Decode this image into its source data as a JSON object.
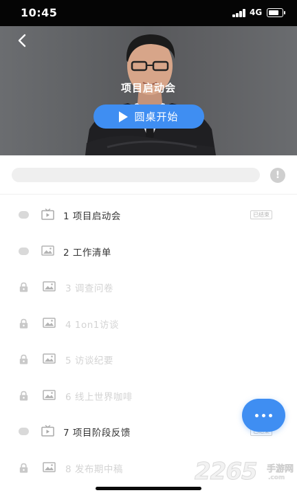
{
  "status_bar": {
    "time": "10:45",
    "network": "4G",
    "battery_level": 0.8
  },
  "header": {
    "title": "项目启动会"
  },
  "start_button": {
    "label": "圆桌开始"
  },
  "info_icon": {
    "glyph": "!"
  },
  "items": [
    {
      "number": "1",
      "title": "项目启动会",
      "label": "1  项目启动会",
      "status_icon": "dot",
      "type_icon": "video-icon",
      "locked": false,
      "badge": "已结束"
    },
    {
      "number": "2",
      "title": "工作清单",
      "label": "2  工作清单",
      "status_icon": "dot",
      "type_icon": "image-icon",
      "locked": false
    },
    {
      "number": "3",
      "title": "调查问卷",
      "label": "3  调查问卷",
      "status_icon": "lock-icon",
      "type_icon": "image-icon",
      "locked": true
    },
    {
      "number": "4",
      "title": "1on1访谈",
      "label": "4  1on1访谈",
      "status_icon": "lock-icon",
      "type_icon": "image-icon",
      "locked": true
    },
    {
      "number": "5",
      "title": "访谈纪要",
      "label": "5  访谈纪要",
      "status_icon": "lock-icon",
      "type_icon": "image-icon",
      "locked": true
    },
    {
      "number": "6",
      "title": "线上世界咖啡",
      "label": "6  线上世界咖啡",
      "status_icon": "lock-icon",
      "type_icon": "image-icon",
      "locked": true
    },
    {
      "number": "7",
      "title": "项目阶段反馈",
      "label": "7  项目阶段反馈",
      "status_icon": "dot",
      "type_icon": "video-icon",
      "locked": false,
      "badge": "已结束"
    },
    {
      "number": "8",
      "title": "发布期中稿",
      "label": "8  发布期中稿",
      "status_icon": "lock-icon",
      "type_icon": "image-icon",
      "locked": true
    }
  ],
  "watermark": {
    "number": "2265",
    "brand": "手游网",
    "url": ".com"
  },
  "colors": {
    "accent": "#3f8ef2",
    "status_bar": "#050505",
    "muted": "#d3d3d3",
    "text": "#333333"
  }
}
